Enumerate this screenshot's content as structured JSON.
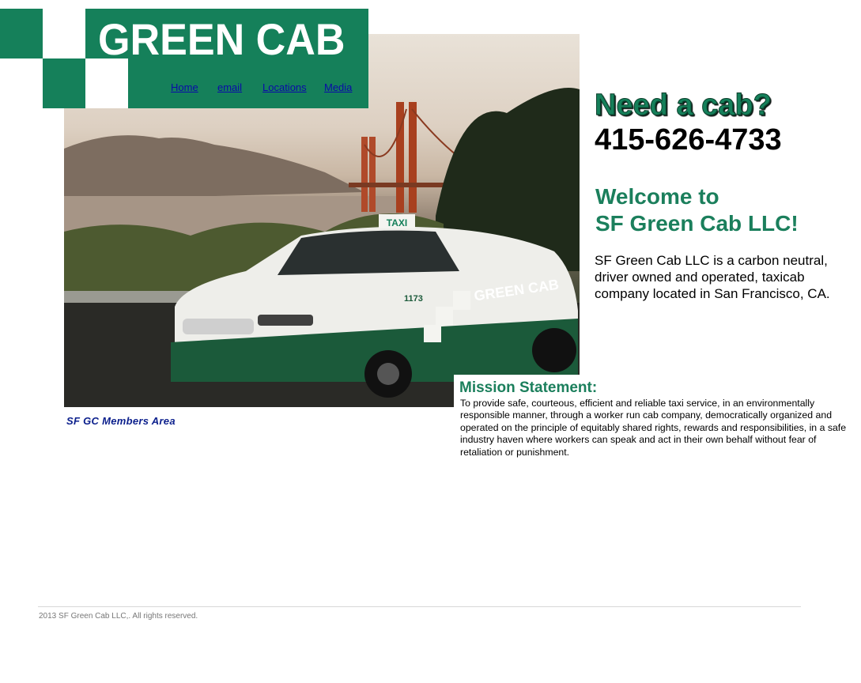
{
  "header": {
    "brand": "GREEN CAB",
    "nav": [
      {
        "label": "Home"
      },
      {
        "label": "email"
      },
      {
        "label": "Locations"
      },
      {
        "label": "Media"
      }
    ]
  },
  "hero": {
    "taxi_sign": "TAXI",
    "car_lettering": "GREEN CAB",
    "car_number": "1173"
  },
  "cta": {
    "headline": "Need a cab?",
    "phone": "415-626-4733"
  },
  "welcome": {
    "line1": "Welcome to",
    "line2": "SF Green Cab LLC!",
    "about": "SF Green Cab LLC is a carbon neutral, driver owned and operated, taxicab company located in San Francisco, CA."
  },
  "mission": {
    "title": "Mission Statement:",
    "text": "To provide safe, courteous, efficient and reliable taxi service, in an environmentally responsible manner, through a worker run cab company, democratically organized and operated on the principle of equitably shared rights, rewards and responsibilities, in a safe industry haven where workers can speak and act in their own behalf without fear of retaliation or punishment."
  },
  "members_link": "SF GC Members Area",
  "footer": {
    "copyright": "2013 SF Green Cab LLC,. All rights reserved."
  },
  "colors": {
    "brand_green": "#15805a",
    "heading_green": "#1b7f5c",
    "link_blue": "#0a0aa8"
  }
}
